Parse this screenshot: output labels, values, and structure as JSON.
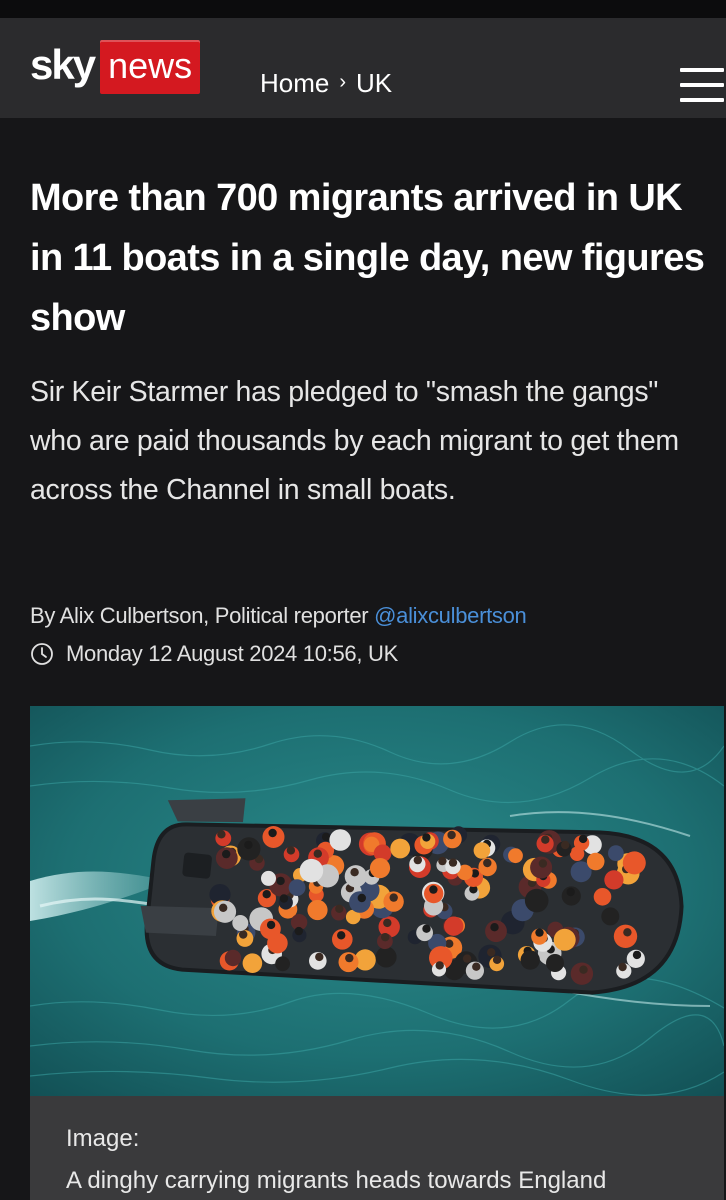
{
  "header": {
    "logo_sky": "sky",
    "logo_news": "news",
    "breadcrumb": [
      {
        "label": "Home"
      },
      {
        "label": "UK"
      }
    ],
    "breadcrumb_separator": "›",
    "menu_icon": "hamburger-menu-icon"
  },
  "article": {
    "headline": "More than 700 migrants arrived in UK in 11 boats in a single day, new figures show",
    "standfirst": "Sir Keir Starmer has pledged to \"smash the gangs\" who are paid thousands by each migrant to get them across the Channel in small boats.",
    "byline_prefix": "By Alix Culbertson, Political reporter",
    "byline_handle": "@alixculbertson",
    "date_icon": "clock-icon",
    "date": "Monday 12 August 2024 10:56, UK",
    "image": {
      "caption_label": "Image:",
      "caption_text": "A dinghy carrying migrants heads towards England"
    }
  },
  "colors": {
    "brand_red": "#d41920",
    "link_blue": "#4a8fd8",
    "page_bg": "#161618",
    "header_bg": "#2b2b2d",
    "caption_bg": "#3a3a3c"
  }
}
